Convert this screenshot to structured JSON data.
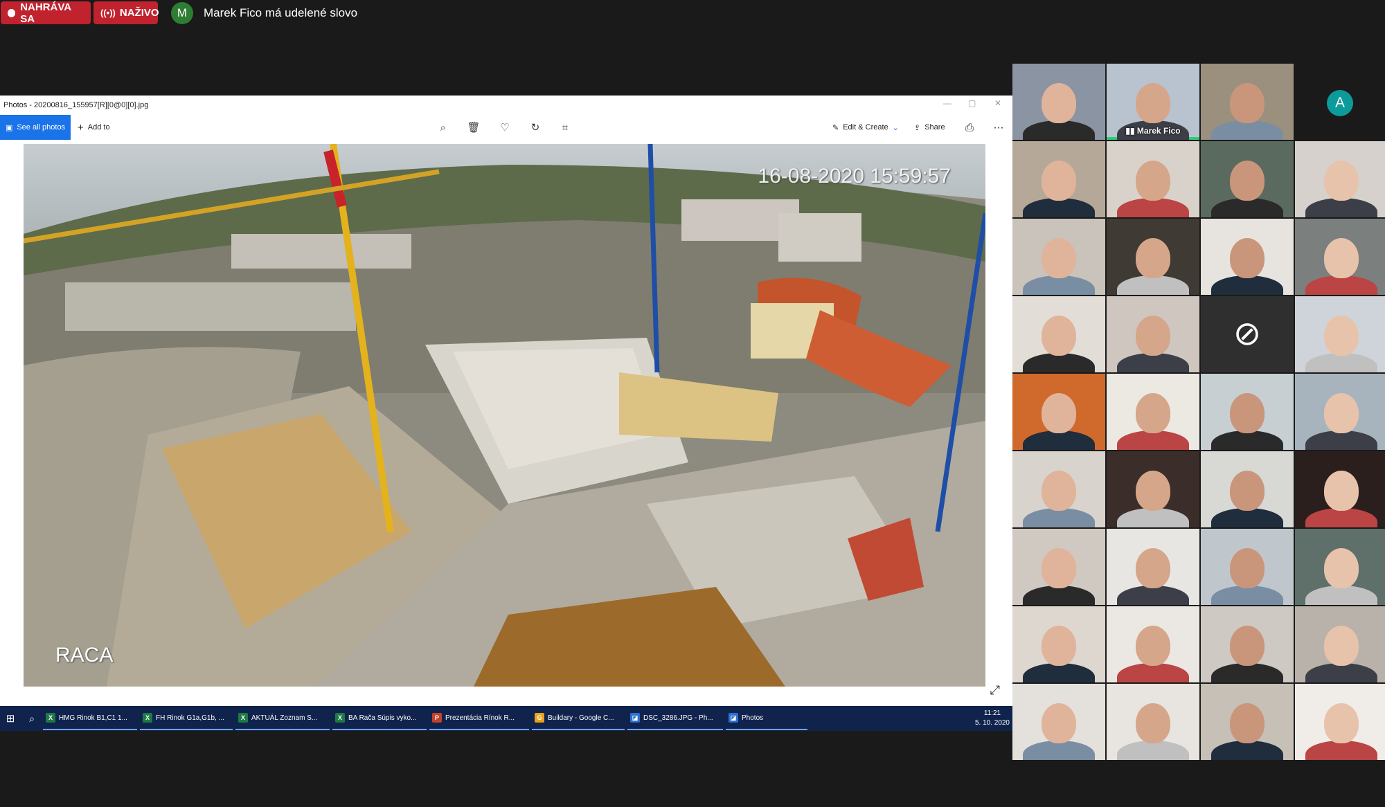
{
  "meeting": {
    "recording_label": "NAHRÁVA SA",
    "live_label": "NAŽIVO",
    "speaker_initial": "M",
    "speaker_text": "Marek Fico má udelené slovo"
  },
  "photos_app": {
    "title": "Photos - 20200816_155957[R][0@0][0].jpg",
    "see_all_label": "See all photos",
    "add_to_label": "Add to",
    "edit_create_label": "Edit & Create",
    "share_label": "Share",
    "photo_timestamp": "16-08-2020 15:59:57",
    "photo_location": "RACA"
  },
  "taskbar": {
    "apps": [
      {
        "label": "HMG Rinok B1,C1 1...",
        "icon": "X",
        "color": "#1d7a45"
      },
      {
        "label": "FH Rinok G1a,G1b, ...",
        "icon": "X",
        "color": "#1d7a45"
      },
      {
        "label": "AKTUÁL Zoznam S...",
        "icon": "X",
        "color": "#1d7a45"
      },
      {
        "label": "BA Rača Súpis vyko...",
        "icon": "X",
        "color": "#1d7a45"
      },
      {
        "label": "Prezentácia Rínok R...",
        "icon": "P",
        "color": "#c4412b"
      },
      {
        "label": "Buildary - Google C...",
        "icon": "G",
        "color": "#e9a21a"
      },
      {
        "label": "DSC_3286.JPG - Ph...",
        "icon": "◪",
        "color": "#2d6fd1"
      },
      {
        "label": "Photos",
        "icon": "◪",
        "color": "#2d6fd1"
      }
    ],
    "time": "11:21",
    "date": "5. 10. 2020"
  },
  "gallery": {
    "active_speaker_name": "Marek Fico",
    "participant_initial": "A"
  }
}
